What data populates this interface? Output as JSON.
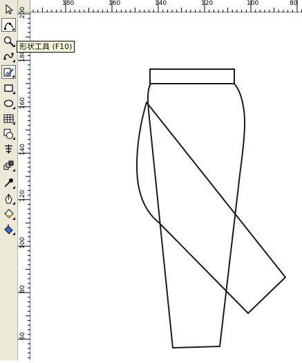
{
  "toolbox": {
    "tools": [
      {
        "name": "pick-tool",
        "icon": "arrow-cursor-icon",
        "active": false,
        "flyout": false
      },
      {
        "name": "shape-tool",
        "icon": "shape-edit-icon",
        "active": true,
        "flyout": true
      },
      {
        "name": "zoom-tool",
        "icon": "magnifier-icon",
        "active": false,
        "flyout": true
      },
      {
        "name": "curve-tool",
        "icon": "freehand-curve-icon",
        "active": false,
        "flyout": true
      },
      {
        "name": "smart-fill-tool",
        "icon": "smart-drawing-icon",
        "active": true,
        "flyout": true
      },
      {
        "name": "rectangle-tool",
        "icon": "rectangle-icon",
        "active": false,
        "flyout": true
      },
      {
        "name": "ellipse-tool",
        "icon": "ellipse-icon",
        "active": false,
        "flyout": true
      },
      {
        "name": "table-tool",
        "icon": "grid-table-icon",
        "active": false,
        "flyout": true
      },
      {
        "name": "basic-shapes-tool",
        "icon": "basic-shapes-icon",
        "active": false,
        "flyout": true
      },
      {
        "name": "text-tool",
        "icon": "text-char-icon",
        "active": false,
        "flyout": false
      },
      {
        "name": "interactive-blend-tool",
        "icon": "blend-icon",
        "active": false,
        "flyout": true
      },
      {
        "name": "eyedropper-tool",
        "icon": "eyedropper-icon",
        "active": false,
        "flyout": true
      },
      {
        "name": "outline-tool",
        "icon": "pen-nib-icon",
        "active": false,
        "flyout": true
      },
      {
        "name": "fill-tool",
        "icon": "paint-bucket-icon",
        "active": false,
        "flyout": true
      },
      {
        "name": "interactive-fill-tool",
        "icon": "interactive-fill-icon",
        "active": false,
        "flyout": true
      }
    ]
  },
  "tooltip": {
    "text": "形状工具 (F10)"
  },
  "rulers": {
    "horizontal_labels": [
      "180",
      "160",
      "140",
      "120",
      "100",
      "80"
    ],
    "vertical_labels": [
      "200",
      "180",
      "160",
      "140",
      "120",
      "100",
      "80",
      "60"
    ]
  },
  "colors": {
    "stroke": "#1a1a1a",
    "toolbox_bg": "#ece9d8",
    "tooltip_bg": "#ffffe1"
  }
}
